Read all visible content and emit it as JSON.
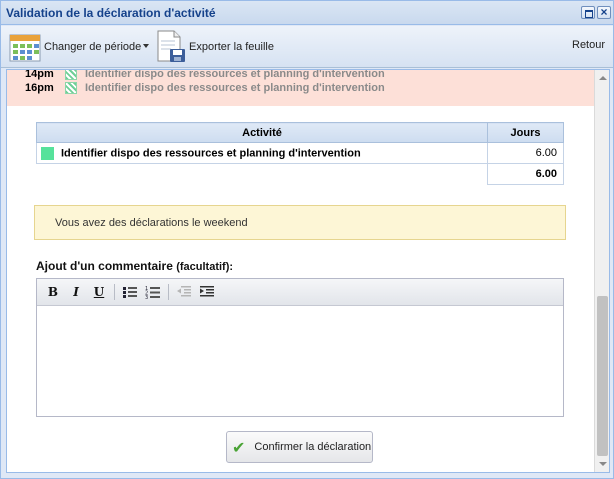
{
  "window": {
    "title": "Validation de la déclaration d'activité"
  },
  "toolbar": {
    "period_label": "Changer de période",
    "export_label": "Exporter la feuille",
    "back_label": "Retour"
  },
  "slots": [
    {
      "time": "14pm",
      "description": "Identifier dispo des ressources et planning d'intervention"
    },
    {
      "time": "16pm",
      "description": "Identifier dispo des ressources et planning d'intervention"
    }
  ],
  "activity_table": {
    "headers": {
      "activity": "Activité",
      "days": "Jours"
    },
    "rows": [
      {
        "name": "Identifier dispo des ressources et planning d'intervention",
        "days": "6.00",
        "color": "#56e29b"
      }
    ],
    "total": "6.00"
  },
  "notice": {
    "text": "Vous avez des déclarations le weekend"
  },
  "comment": {
    "label": "Ajout d'un commentaire",
    "optional": "(facultatif):",
    "value": ""
  },
  "confirm": {
    "label": "Confirmer la déclaration"
  },
  "colors": {
    "accent": "#15428b",
    "notice_bg": "#fdf6d6",
    "band_bg": "#fde0d8"
  }
}
